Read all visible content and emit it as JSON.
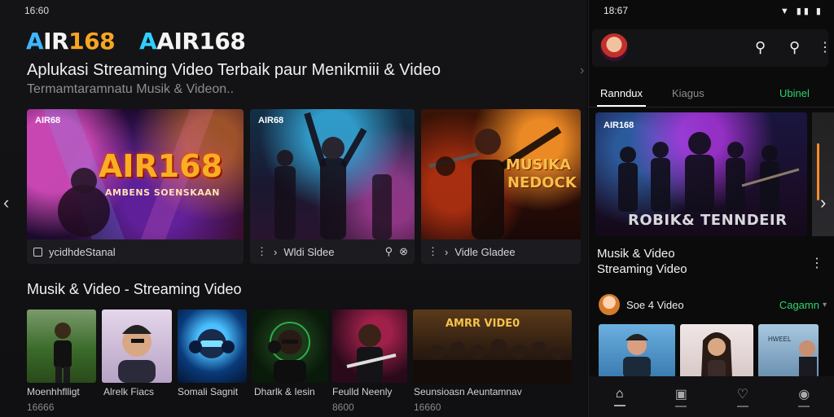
{
  "desktop": {
    "status_time": "16:60",
    "logo_primary": {
      "a": "A",
      "rest": "IR",
      "num": "168"
    },
    "logo_secondary": {
      "a": "A",
      "rest": "AIR",
      "num": "168"
    },
    "headline": "Aplukasi Streaming Video Terbaik paur Menikmiii & Video",
    "subline": "Termamtaramnatu Musik & Videon..",
    "featured": [
      {
        "tag": "AIR68",
        "title_top": "AIR168",
        "title_sub": "AMBENS SOENSKAAN",
        "bar_label": "ycidhdeStanal",
        "bar_icon": "square-icon"
      },
      {
        "tag": "AIR68",
        "title_top": "",
        "title_sub": "",
        "bar_label": "Wldi Sldee",
        "bar_icon": "list-icon"
      },
      {
        "tag": "",
        "title_top": "MUSIKA",
        "title_sub": "NEDOCK",
        "bar_label": "Vidle Gladee",
        "bar_icon": "list-icon"
      }
    ],
    "section_title": "Musik & Video - Streaming Video",
    "thumbs": [
      {
        "label": "Moenhhflligt",
        "sub": "16666"
      },
      {
        "label": "Alrelk Fiacs",
        "sub": ""
      },
      {
        "label": "Somali Sagnit",
        "sub": ""
      },
      {
        "label": "Dharlk & Iesin",
        "sub": ""
      },
      {
        "label": "Feulld Neenly",
        "sub": "8600"
      },
      {
        "label": "Seunsioasn   Aeuntamnav",
        "sub": "16660",
        "poster": "AMRR VIDE0"
      }
    ]
  },
  "phone": {
    "status_time": "18:67",
    "tabs": [
      {
        "label": "Ranndux",
        "state": "active"
      },
      {
        "label": "Kiagus",
        "state": "muted"
      },
      {
        "label": "Ubinel",
        "state": "green"
      }
    ],
    "hero": {
      "tag": "AIR168",
      "title": "ROBIK& TENNDEIR"
    },
    "hero_caption": "Musik & Video\nStreaming Video",
    "row_title": "Soe 4 Video",
    "row_link": "Cagamn",
    "third_thumb_tag": "HWEEL"
  },
  "colors": {
    "accent_blue": "#3fb6ff",
    "accent_orange": "#f6a623",
    "accent_green": "#2bd46a"
  }
}
